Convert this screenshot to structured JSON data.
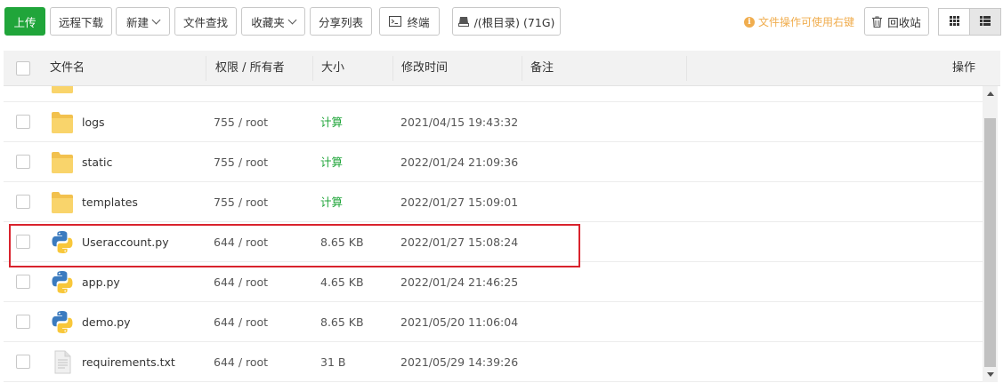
{
  "toolbar": {
    "upload": "上传",
    "remote_download": "远程下载",
    "new": "新建",
    "file_search": "文件查找",
    "favorites": "收藏夹",
    "share_list": "分享列表",
    "terminal": "终端",
    "disk": "/(根目录) (71G)",
    "hint": "文件操作可使用右键",
    "recycle_bin": "回收站"
  },
  "table": {
    "headers": {
      "name": "文件名",
      "permission": "权限 / 所有者",
      "size": "大小",
      "mtime": "修改时间",
      "note": "备注",
      "action": "操作"
    },
    "rows": [
      {
        "name": "logs",
        "perm": "755 / root",
        "size": "计算",
        "mtime": "2021/04/15 19:43:32",
        "icon": "folder-icon"
      },
      {
        "name": "static",
        "perm": "755 / root",
        "size": "计算",
        "mtime": "2022/01/24 21:09:36",
        "icon": "folder-icon"
      },
      {
        "name": "templates",
        "perm": "755 / root",
        "size": "计算",
        "mtime": "2022/01/27 15:09:01",
        "icon": "folder-icon"
      },
      {
        "name": "Useraccount.py",
        "perm": "644 / root",
        "size": "8.65 KB",
        "mtime": "2022/01/27 15:08:24",
        "icon": "python-file-icon"
      },
      {
        "name": "app.py",
        "perm": "644 / root",
        "size": "4.65 KB",
        "mtime": "2022/01/24 21:46:25",
        "icon": "python-file-icon"
      },
      {
        "name": "demo.py",
        "perm": "644 / root",
        "size": "8.65 KB",
        "mtime": "2021/05/20 11:06:04",
        "icon": "python-file-icon"
      },
      {
        "name": "requirements.txt",
        "perm": "644 / root",
        "size": "31 B",
        "mtime": "2021/05/29 14:39:26",
        "icon": "text-file-icon"
      }
    ]
  },
  "colors": {
    "primary": "#20a53a",
    "hint": "#f0ad4e",
    "highlight": "#d9232d",
    "folder": "#f7c948"
  }
}
